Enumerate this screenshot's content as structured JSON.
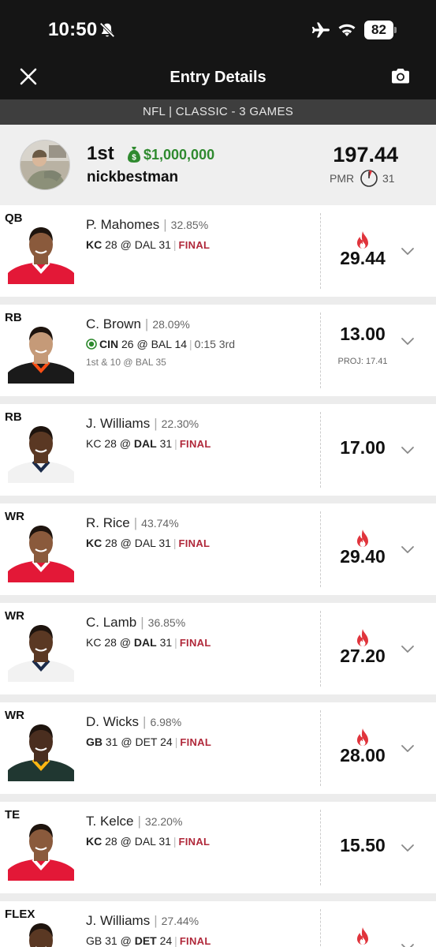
{
  "status_bar": {
    "time": "10:50",
    "battery": "82"
  },
  "nav": {
    "title": "Entry Details"
  },
  "contest": {
    "label": "NFL | CLASSIC - 3 GAMES"
  },
  "summary": {
    "place": "1st",
    "prize": "$1,000,000",
    "username": "nickbestman",
    "score": "197.44",
    "pmr_label": "PMR",
    "pmr_value": "31"
  },
  "colors": {
    "header_bg": "#151515",
    "contest_bar_bg": "#3e3e3e",
    "prize_green": "#2f8a2f",
    "final_red": "#b0283a",
    "fire_red": "#e0343c",
    "kc_red": "#e31837",
    "cin_orange": "#fb4f14",
    "gb_green": "#203731",
    "live_green": "#2f8a2f"
  },
  "players": [
    {
      "position": "QB",
      "name": "P. Mahomes",
      "ownership": "32.85%",
      "game": {
        "team1": "KC",
        "score1": "28",
        "at": "@",
        "team2": "DAL",
        "score2": "31",
        "bold": 1,
        "status": "FINAL"
      },
      "points": "29.44",
      "hot": true,
      "icon": "kc-player-headshot"
    },
    {
      "position": "RB",
      "name": "C. Brown",
      "ownership": "28.09%",
      "game": {
        "team1": "CIN",
        "score1": "26",
        "at": "@",
        "team2": "BAL",
        "score2": "14",
        "bold": 1,
        "status": "0:15 3rd",
        "live": true
      },
      "situation": "1st & 10 @ BAL 35",
      "points": "13.00",
      "proj": "PROJ: 17.41",
      "hot": false,
      "icon": "cin-player-headshot"
    },
    {
      "position": "RB",
      "name": "J. Williams",
      "ownership": "22.30%",
      "game": {
        "team1": "KC",
        "score1": "28",
        "at": "@",
        "team2": "DAL",
        "score2": "31",
        "bold": 2,
        "status": "FINAL"
      },
      "points": "17.00",
      "hot": false,
      "icon": "dal-player-headshot"
    },
    {
      "position": "WR",
      "name": "R. Rice",
      "ownership": "43.74%",
      "game": {
        "team1": "KC",
        "score1": "28",
        "at": "@",
        "team2": "DAL",
        "score2": "31",
        "bold": 1,
        "status": "FINAL"
      },
      "points": "29.40",
      "hot": true,
      "icon": "kc-player-headshot"
    },
    {
      "position": "WR",
      "name": "C. Lamb",
      "ownership": "36.85%",
      "game": {
        "team1": "KC",
        "score1": "28",
        "at": "@",
        "team2": "DAL",
        "score2": "31",
        "bold": 2,
        "status": "FINAL"
      },
      "points": "27.20",
      "hot": true,
      "icon": "dal-player-headshot"
    },
    {
      "position": "WR",
      "name": "D. Wicks",
      "ownership": "6.98%",
      "game": {
        "team1": "GB",
        "score1": "31",
        "at": "@",
        "team2": "DET",
        "score2": "24",
        "bold": 1,
        "status": "FINAL"
      },
      "points": "28.00",
      "hot": true,
      "icon": "gb-player-headshot"
    },
    {
      "position": "TE",
      "name": "T. Kelce",
      "ownership": "32.20%",
      "game": {
        "team1": "KC",
        "score1": "28",
        "at": "@",
        "team2": "DAL",
        "score2": "31",
        "bold": 1,
        "status": "FINAL"
      },
      "points": "15.50",
      "hot": false,
      "icon": "kc-player-headshot"
    },
    {
      "position": "FLEX",
      "name": "J. Williams",
      "ownership": "27.44%",
      "game": {
        "team1": "GB",
        "score1": "31",
        "at": "@",
        "team2": "DET",
        "score2": "24",
        "bold": 2,
        "status": "FINAL"
      },
      "points": "",
      "hot": true,
      "icon": "det-player-headshot"
    }
  ]
}
